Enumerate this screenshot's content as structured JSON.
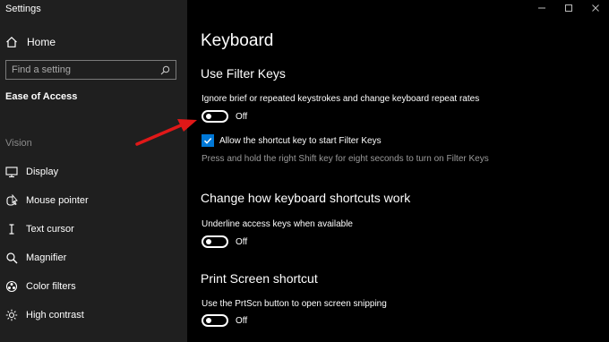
{
  "app": {
    "title": "Settings"
  },
  "sidebar": {
    "home_label": "Home",
    "search_placeholder": "Find a setting",
    "section_heading": "Ease of Access",
    "group_label": "Vision",
    "items": [
      {
        "label": "Display",
        "icon": "monitor-icon"
      },
      {
        "label": "Mouse pointer",
        "icon": "mouse-pointer-icon"
      },
      {
        "label": "Text cursor",
        "icon": "text-cursor-icon"
      },
      {
        "label": "Magnifier",
        "icon": "magnifier-icon"
      },
      {
        "label": "Color filters",
        "icon": "color-filters-icon"
      },
      {
        "label": "High contrast",
        "icon": "high-contrast-icon"
      }
    ]
  },
  "main": {
    "page_title": "Keyboard",
    "filter_keys": {
      "heading": "Use Filter Keys",
      "description": "Ignore brief or repeated keystrokes and change keyboard repeat rates",
      "toggle_state": "Off",
      "checkbox_label": "Allow the shortcut key to start Filter Keys",
      "checkbox_checked": true,
      "hint": "Press and hold the right Shift key for eight seconds to turn on Filter Keys"
    },
    "shortcuts": {
      "heading": "Change how keyboard shortcuts work",
      "description": "Underline access keys when available",
      "toggle_state": "Off"
    },
    "print_screen": {
      "heading": "Print Screen shortcut",
      "description": "Use the PrtScn button to open screen snipping",
      "toggle_state": "Off"
    }
  },
  "colors": {
    "accent": "#0078d7",
    "annotation_arrow": "#e01818",
    "sidebar_bg": "#1f1f1f",
    "main_bg": "#000000"
  }
}
